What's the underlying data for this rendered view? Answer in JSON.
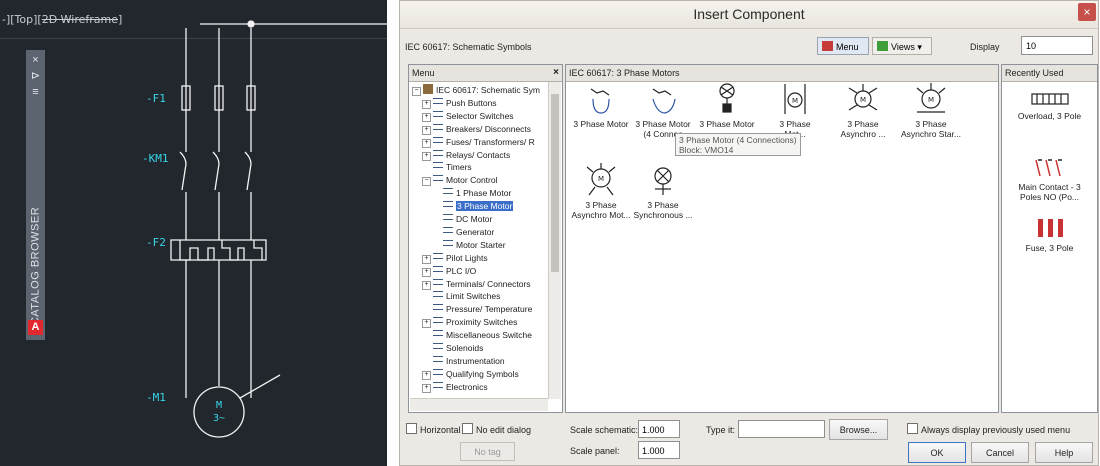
{
  "cad": {
    "view_label_prefix": "-][Top][",
    "view_label_struck": "2D Wireframe",
    "view_label_suffix": "]",
    "palette_title": "CATALOG BROWSER",
    "palette_logo": "A",
    "palette_buttons": [
      "×",
      "⊳",
      "≡"
    ],
    "refs": {
      "fuse": "-F1",
      "contactor": "-KM1",
      "overload": "-F2",
      "motor": "-M1"
    },
    "motor_symbol_top": "M",
    "motor_symbol_bottom": "3~",
    "colors": {
      "background": "#22272e",
      "wire": "#f2f2f2",
      "label": "#37d6e8"
    }
  },
  "dialog": {
    "title": "Insert Component",
    "close_label": "×",
    "library_name": "IEC 60617: Schematic Symbols",
    "menu_button": "Menu",
    "views_button": "Views ▾",
    "display_label": "Display",
    "display_value": "10"
  },
  "tree": {
    "header": "Menu",
    "close": "×",
    "items": [
      {
        "label": "IEC 60617: Schematic Sym",
        "level": 0,
        "exp": "−",
        "root": true
      },
      {
        "label": "Push Buttons",
        "level": 1,
        "exp": "+"
      },
      {
        "label": "Selector Switches",
        "level": 1,
        "exp": "+"
      },
      {
        "label": "Breakers/ Disconnects",
        "level": 1,
        "exp": "+"
      },
      {
        "label": "Fuses/ Transformers/ R",
        "level": 1,
        "exp": "+"
      },
      {
        "label": "Relays/ Contacts",
        "level": 1,
        "exp": "+"
      },
      {
        "label": "Timers",
        "level": 1,
        "exp": ""
      },
      {
        "label": "Motor Control",
        "level": 1,
        "exp": "−"
      },
      {
        "label": "1 Phase Motor",
        "level": 2,
        "exp": ""
      },
      {
        "label": "3 Phase Motor",
        "level": 2,
        "exp": "",
        "selected": true
      },
      {
        "label": "DC Motor",
        "level": 2,
        "exp": ""
      },
      {
        "label": "Generator",
        "level": 2,
        "exp": ""
      },
      {
        "label": "Motor Starter",
        "level": 2,
        "exp": ""
      },
      {
        "label": "Pilot Lights",
        "level": 1,
        "exp": "+"
      },
      {
        "label": "PLC I/O",
        "level": 1,
        "exp": "+"
      },
      {
        "label": "Terminals/ Connectors",
        "level": 1,
        "exp": "+"
      },
      {
        "label": "Limit Switches",
        "level": 1,
        "exp": ""
      },
      {
        "label": "Pressure/ Temperature",
        "level": 1,
        "exp": ""
      },
      {
        "label": "Proximity Switches",
        "level": 1,
        "exp": "+"
      },
      {
        "label": "Miscellaneous Switche",
        "level": 1,
        "exp": ""
      },
      {
        "label": "Solenoids",
        "level": 1,
        "exp": ""
      },
      {
        "label": "Instrumentation",
        "level": 1,
        "exp": ""
      },
      {
        "label": "Qualifying Symbols",
        "level": 1,
        "exp": "+"
      },
      {
        "label": "Electronics",
        "level": 1,
        "exp": "+"
      }
    ]
  },
  "components": {
    "header": "IEC 60617: 3 Phase Motors",
    "items": [
      {
        "line1": "3 Phase Motor",
        "line2": ""
      },
      {
        "line1": "3 Phase Motor",
        "line2": "(4 Connec"
      },
      {
        "line1": "3 Phase Motor",
        "line2": ""
      },
      {
        "line1": "3 Phase",
        "line2": "Mot..."
      },
      {
        "line1": "3 Phase",
        "line2": "Asynchro ..."
      },
      {
        "line1": "3 Phase",
        "line2": "Asynchro Star..."
      },
      {
        "line1": "3 Phase",
        "line2": "Asynchro Mot..."
      },
      {
        "line1": "3 Phase",
        "line2": "Synchronous ..."
      }
    ],
    "tooltip_line1": "3 Phase Motor (4 Connections)",
    "tooltip_line2": "Block: VMO14"
  },
  "recent": {
    "header": "Recently Used",
    "items": [
      {
        "line1": "Overload, 3 Pole",
        "line2": ""
      },
      {
        "line1": "Main Contact - 3",
        "line2": "Poles NO (Po..."
      },
      {
        "line1": "Fuse, 3 Pole",
        "line2": ""
      }
    ]
  },
  "footer": {
    "horizontal": "Horizontal",
    "no_edit": "No edit dialog",
    "no_tag": "No tag",
    "scale_schematic_label": "Scale schematic:",
    "scale_schematic_value": "1.000",
    "scale_panel_label": "Scale panel:",
    "scale_panel_value": "1.000",
    "type_label": "Type it:",
    "type_value": "",
    "browse": "Browse...",
    "always_display": "Always display previously used menu",
    "ok": "OK",
    "cancel": "Cancel",
    "help": "Help"
  }
}
